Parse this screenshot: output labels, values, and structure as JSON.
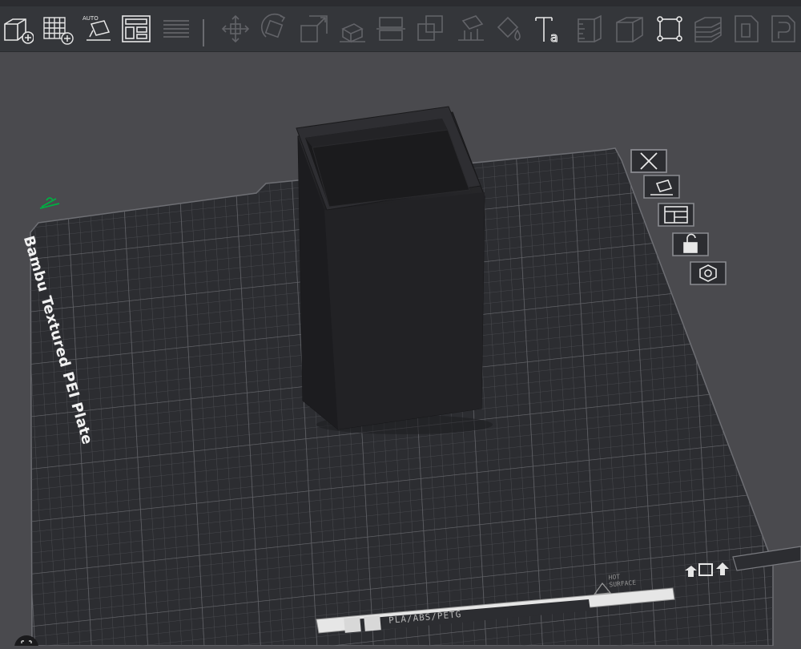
{
  "toolbar": {
    "buttons": [
      {
        "icon": "add-object-icon"
      },
      {
        "icon": "add-plate-icon"
      },
      {
        "icon": "auto-orient-icon",
        "badge": "AUTO"
      },
      {
        "icon": "arrange-icon"
      },
      {
        "icon": "layers-icon"
      },
      {
        "icon": "move-icon"
      },
      {
        "icon": "rotate-icon"
      },
      {
        "icon": "scale-icon"
      },
      {
        "icon": "lay-on-face-icon"
      },
      {
        "icon": "cut-icon"
      },
      {
        "icon": "boolean-icon"
      },
      {
        "icon": "support-paint-icon"
      },
      {
        "icon": "seam-paint-icon"
      },
      {
        "icon": "text-icon"
      },
      {
        "icon": "measure-icon"
      },
      {
        "icon": "assembly-icon"
      },
      {
        "icon": "variable-layer-icon"
      },
      {
        "icon": "slice-icon"
      },
      {
        "icon": "print-icon"
      }
    ]
  },
  "plate": {
    "name": "Bambu Textured PEI Plate",
    "filament_types": "PLA/ABS/PETG",
    "hot_warning": "HOT\nSURFACE"
  },
  "plate_controls": [
    {
      "icon": "close-icon"
    },
    {
      "icon": "auto-orient-plate-icon"
    },
    {
      "icon": "arrange-plate-icon"
    },
    {
      "icon": "unlock-icon"
    },
    {
      "icon": "plate-settings-icon"
    }
  ],
  "colors": {
    "background": "#4a4a4e",
    "toolbar": "#34363a",
    "plate": "#2c2d31",
    "grid": "#5a5b60",
    "object": "#252528",
    "accent_green": "#00ae42"
  }
}
